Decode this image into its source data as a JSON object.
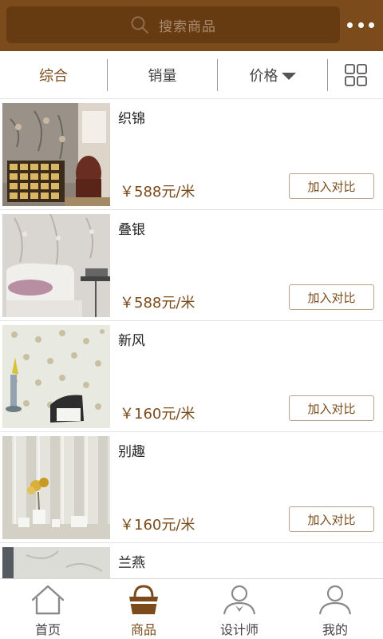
{
  "search": {
    "placeholder": "搜索商品"
  },
  "sort": {
    "items": [
      {
        "label": "综合",
        "active": true
      },
      {
        "label": "销量",
        "active": false
      },
      {
        "label": "价格",
        "active": false
      }
    ]
  },
  "products": [
    {
      "name": "织锦",
      "price": "￥588元/米",
      "button": "加入对比"
    },
    {
      "name": "叠银",
      "price": "￥588元/米",
      "button": "加入对比"
    },
    {
      "name": "新风",
      "price": "￥160元/米",
      "button": "加入对比"
    },
    {
      "name": "别趣",
      "price": "￥160元/米",
      "button": "加入对比"
    },
    {
      "name": "兰燕"
    }
  ],
  "tabbar": {
    "items": [
      {
        "label": "首页",
        "icon": "home-icon"
      },
      {
        "label": "商品",
        "icon": "basket-icon",
        "active": true
      },
      {
        "label": "设计师",
        "icon": "designer-icon"
      },
      {
        "label": "我的",
        "icon": "user-icon"
      }
    ]
  },
  "colors": {
    "brand": "#7b4b1c",
    "searchbox": "#673b12"
  }
}
